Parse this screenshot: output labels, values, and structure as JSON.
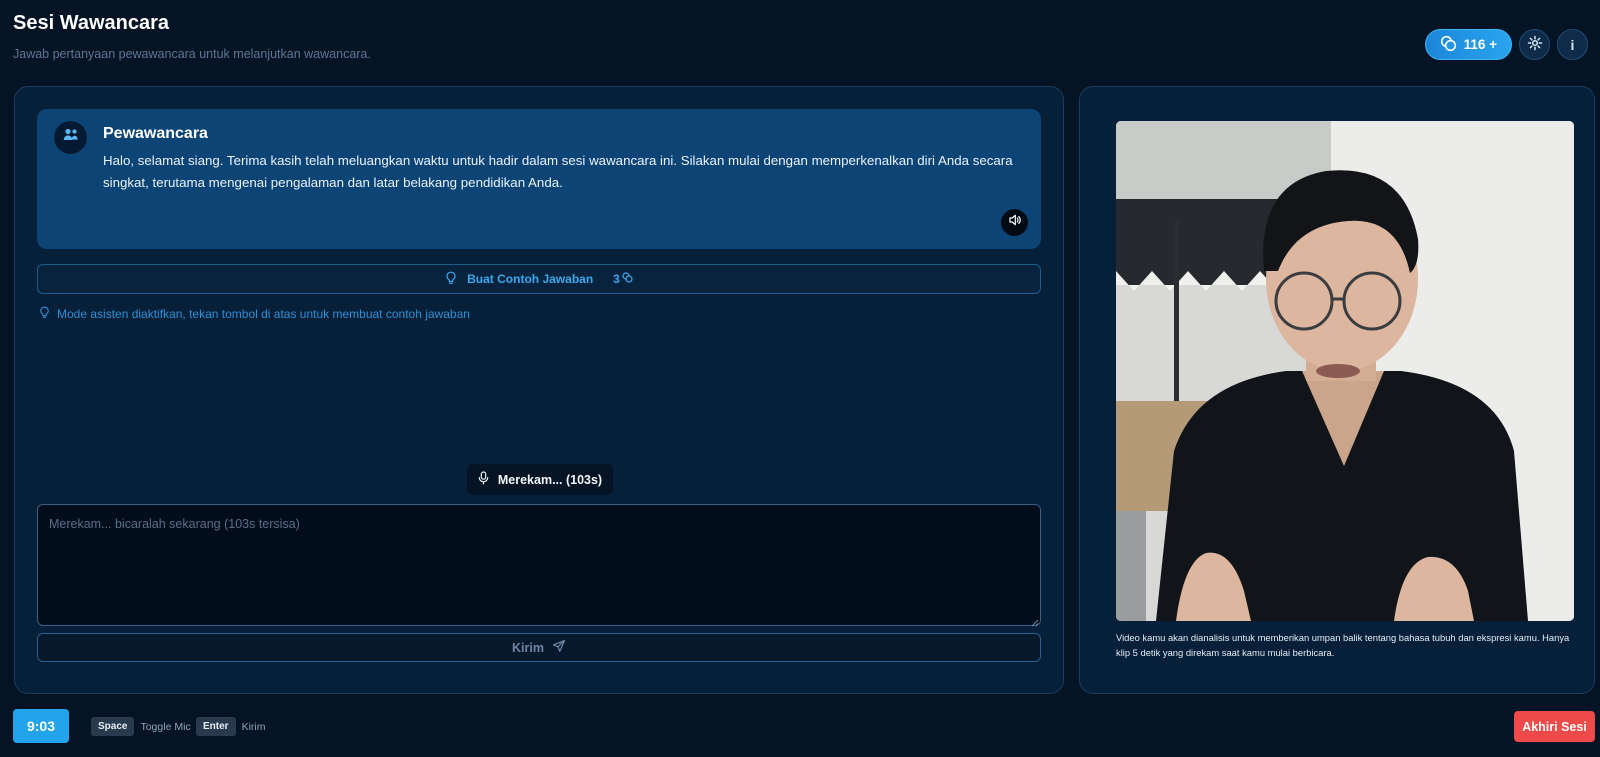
{
  "header": {
    "title": "Sesi Wawancara",
    "subtitle": "Jawab pertanyaan pewawancara untuk melanjutkan wawancara.",
    "credits_label": "116 +",
    "info_label": "i"
  },
  "interviewer": {
    "name": "Pewawancara",
    "message": "Halo, selamat siang. Terima kasih telah meluangkan waktu untuk hadir dalam sesi wawancara ini. Silakan mulai dengan memperkenalkan diri Anda secara singkat, terutama mengenai pengalaman dan latar belakang pendidikan Anda."
  },
  "assistant": {
    "button_label": "Buat Contoh Jawaban",
    "cost": "3",
    "note": "Mode asisten diaktifkan, tekan tombol di atas untuk membuat contoh jawaban"
  },
  "recording": {
    "label": "Merekam... (103s)"
  },
  "answer": {
    "placeholder": "Merekam... bicaralah sekarang (103s tersisa)",
    "value": ""
  },
  "send": {
    "label": "Kirim"
  },
  "camera": {
    "caption": "Video kamu akan dianalisis untuk memberikan umpan balik tentang bahasa tubuh dan ekspresi kamu. Hanya klip 5 detik yang direkam saat kamu mulai berbicara."
  },
  "footer": {
    "timer": "9:03",
    "shortcuts": [
      {
        "key": "Space",
        "action": "Toggle Mic"
      },
      {
        "key": "Enter",
        "action": "Kirim"
      }
    ],
    "end_label": "Akhiri Sesi"
  },
  "colors": {
    "background": "#041425",
    "panel": "#06203a",
    "interviewer_card": "#0c4476",
    "accent": "#22a3ec",
    "danger": "#ef4a4a"
  }
}
